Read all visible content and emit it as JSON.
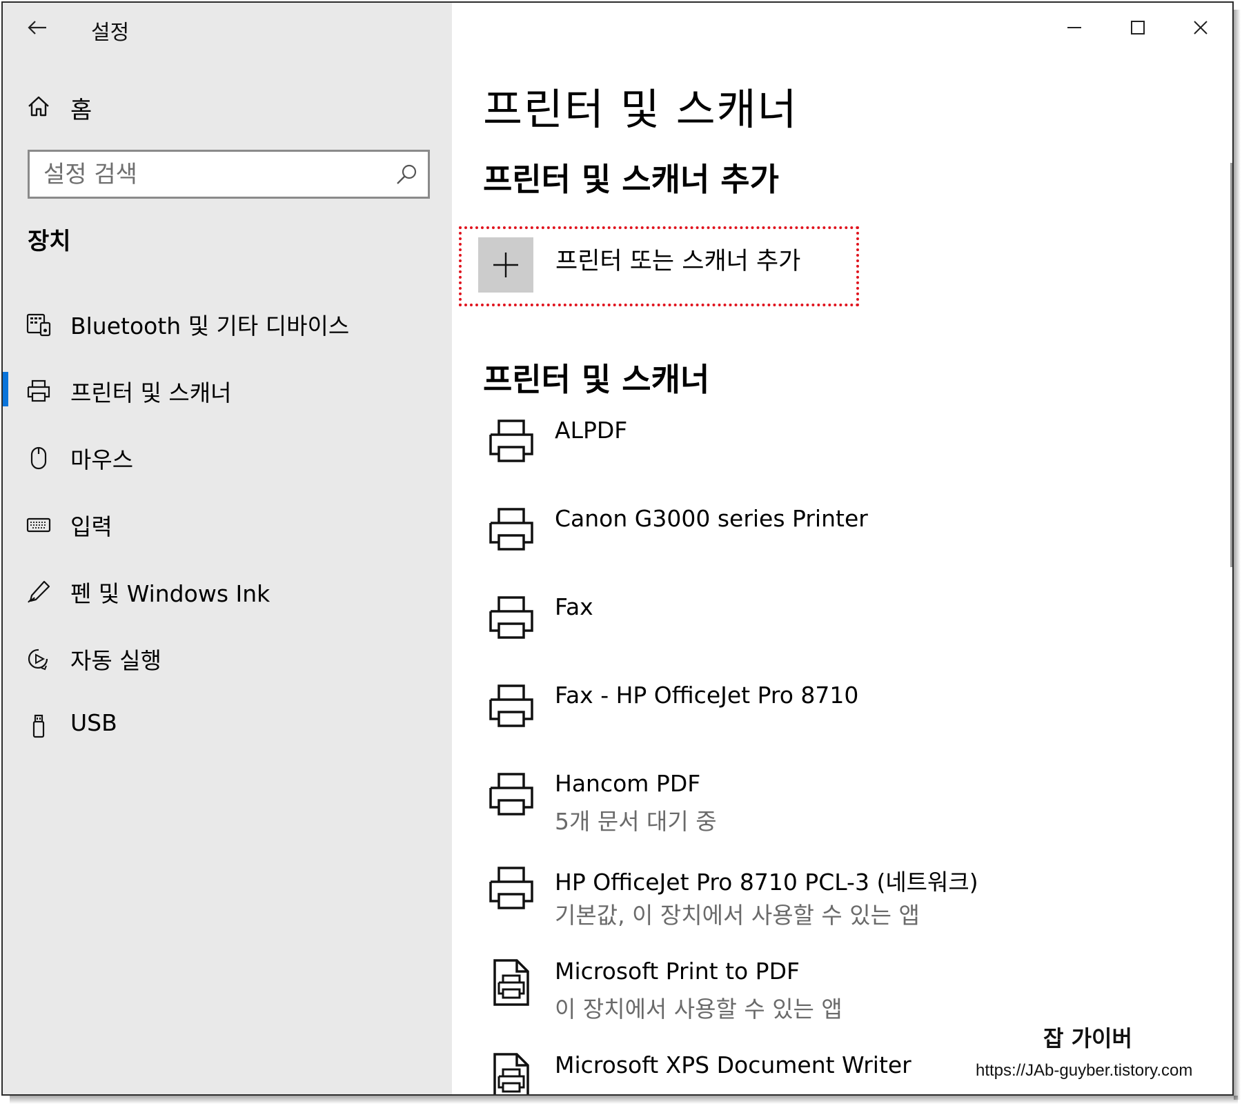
{
  "window": {
    "app_title": "설정",
    "controls": [
      "minimize-icon",
      "maximize-icon",
      "close-icon"
    ]
  },
  "sidebar": {
    "home_label": "홈",
    "search": {
      "placeholder": "설정 검색",
      "value": ""
    },
    "section_title": "장치",
    "items": [
      {
        "label": "Bluetooth 및 기타 디바이스",
        "icon": "bluetooth-devices-icon",
        "selected": false
      },
      {
        "label": "프린터 및 스캐너",
        "icon": "printer-icon",
        "selected": true
      },
      {
        "label": "마우스",
        "icon": "mouse-icon",
        "selected": false
      },
      {
        "label": "입력",
        "icon": "keyboard-icon",
        "selected": false
      },
      {
        "label": "펜 및 Windows Ink",
        "icon": "pen-icon",
        "selected": false
      },
      {
        "label": "자동 실행",
        "icon": "autoplay-icon",
        "selected": false
      },
      {
        "label": "USB",
        "icon": "usb-icon",
        "selected": false
      }
    ]
  },
  "main": {
    "page_title": "프린터 및 스캐너",
    "add_section_title": "프린터 및 스캐너 추가",
    "add_button_label": "프린터 또는 스캐너 추가",
    "list_section_title": "프린터 및 스캐너",
    "printers": [
      {
        "name": "ALPDF",
        "status": "",
        "icon": "printer-icon"
      },
      {
        "name": "Canon G3000 series Printer",
        "status": "",
        "icon": "printer-icon"
      },
      {
        "name": "Fax",
        "status": "",
        "icon": "printer-icon"
      },
      {
        "name": "Fax - HP OfficeJet Pro 8710",
        "status": "",
        "icon": "printer-icon"
      },
      {
        "name": "Hancom PDF",
        "status": "5개 문서 대기 중",
        "icon": "printer-icon"
      },
      {
        "name": "HP OfficeJet Pro 8710 PCL-3 (네트워크)",
        "status": "기본값, 이 장치에서 사용할 수 있는 앱",
        "icon": "printer-icon"
      },
      {
        "name": "Microsoft Print to PDF",
        "status": "이 장치에서 사용할 수 있는 앱",
        "icon": "pdf-printer-icon"
      },
      {
        "name": "Microsoft XPS Document Writer",
        "status": "",
        "icon": "pdf-printer-icon"
      }
    ]
  },
  "watermark": {
    "title": "잡 가이버",
    "url": "https://JAb-guyber.tistory.com"
  },
  "colors": {
    "sidebar_bg": "#e9e9e9",
    "accent": "#0a74da",
    "highlight_border": "#e0141e",
    "add_tile": "#cccccc"
  }
}
